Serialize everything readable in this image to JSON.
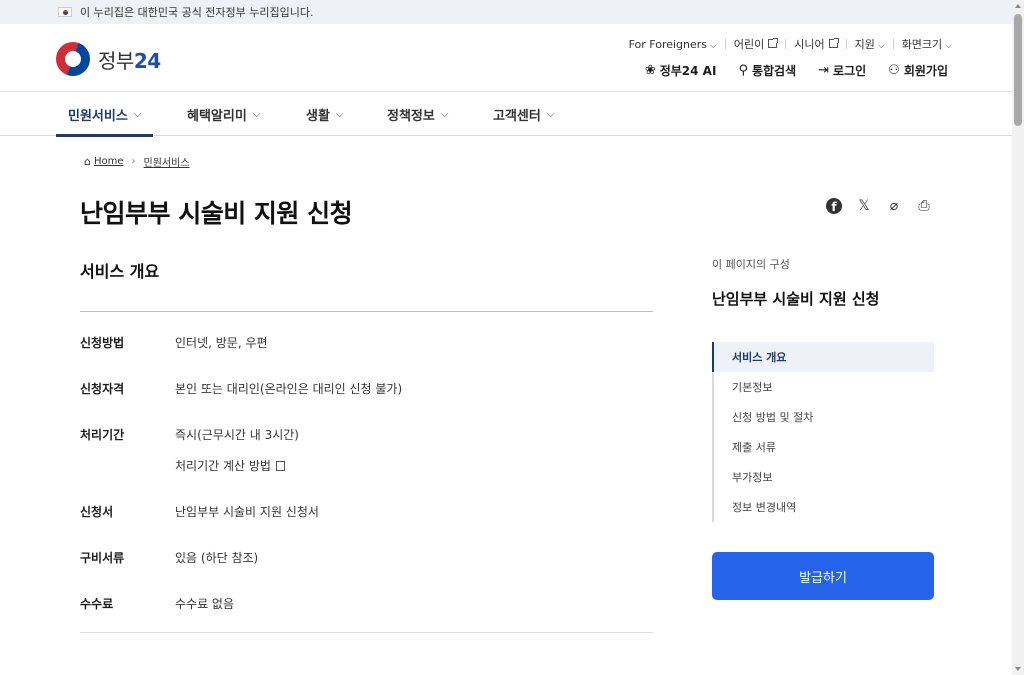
{
  "banner": {
    "text": "이 누리집은 대한민국 공식 전자정부 누리집입니다."
  },
  "header": {
    "logo_text": "정부",
    "logo_num": "24",
    "util": {
      "foreigners": "For Foreigners",
      "kids": "어린이",
      "senior": "시니어",
      "support": "지원",
      "screen_size": "화면크기"
    },
    "main_util": {
      "ai": "정부24 AI",
      "search": "통합검색",
      "login": "로그인",
      "signup": "회원가입"
    }
  },
  "gnb": {
    "items": [
      {
        "label": "민원서비스",
        "active": true
      },
      {
        "label": "혜택알리미"
      },
      {
        "label": "생활"
      },
      {
        "label": "정책정보"
      },
      {
        "label": "고객센터"
      }
    ]
  },
  "breadcrumb": {
    "home": "Home",
    "current": "민원서비스"
  },
  "page": {
    "title": "난임부부 시술비 지원 신청"
  },
  "overview": {
    "title": "서비스 개요",
    "rows": [
      {
        "key": "신청방법",
        "value": "인터넷, 방문, 우편"
      },
      {
        "key": "신청자격",
        "value": "본인 또는 대리인(온라인은 대리인 신청 불가)"
      },
      {
        "key": "처리기간",
        "value": "즉시(근무시간 내 3시간)",
        "extra": "처리기간 계산 방법"
      },
      {
        "key": "신청서",
        "value": "난임부부 시술비 지원 신청서"
      },
      {
        "key": "구비서류",
        "value": "있음 (하단 참조)"
      },
      {
        "key": "수수료",
        "value": "수수료 없음"
      }
    ]
  },
  "toc": {
    "label": "이 페이지의 구성",
    "title": "난임부부 시술비 지원 신청",
    "items": [
      {
        "label": "서비스 개요",
        "active": true
      },
      {
        "label": "기본정보"
      },
      {
        "label": "신청 방법 및 절차"
      },
      {
        "label": "제출 서류"
      },
      {
        "label": "부가정보"
      },
      {
        "label": "정보 변경내역"
      }
    ]
  },
  "apply_button": {
    "label": "발급하기"
  },
  "colors": {
    "primary": "#2563eb",
    "navy": "#1e3a6e"
  },
  "icons": [
    "flag-icon",
    "chevron-down-icon",
    "external-link-icon",
    "ai-icon",
    "search-icon",
    "login-icon",
    "signup-icon",
    "home-icon",
    "facebook-icon",
    "x-icon",
    "link-icon",
    "print-icon",
    "copy-icon"
  ]
}
